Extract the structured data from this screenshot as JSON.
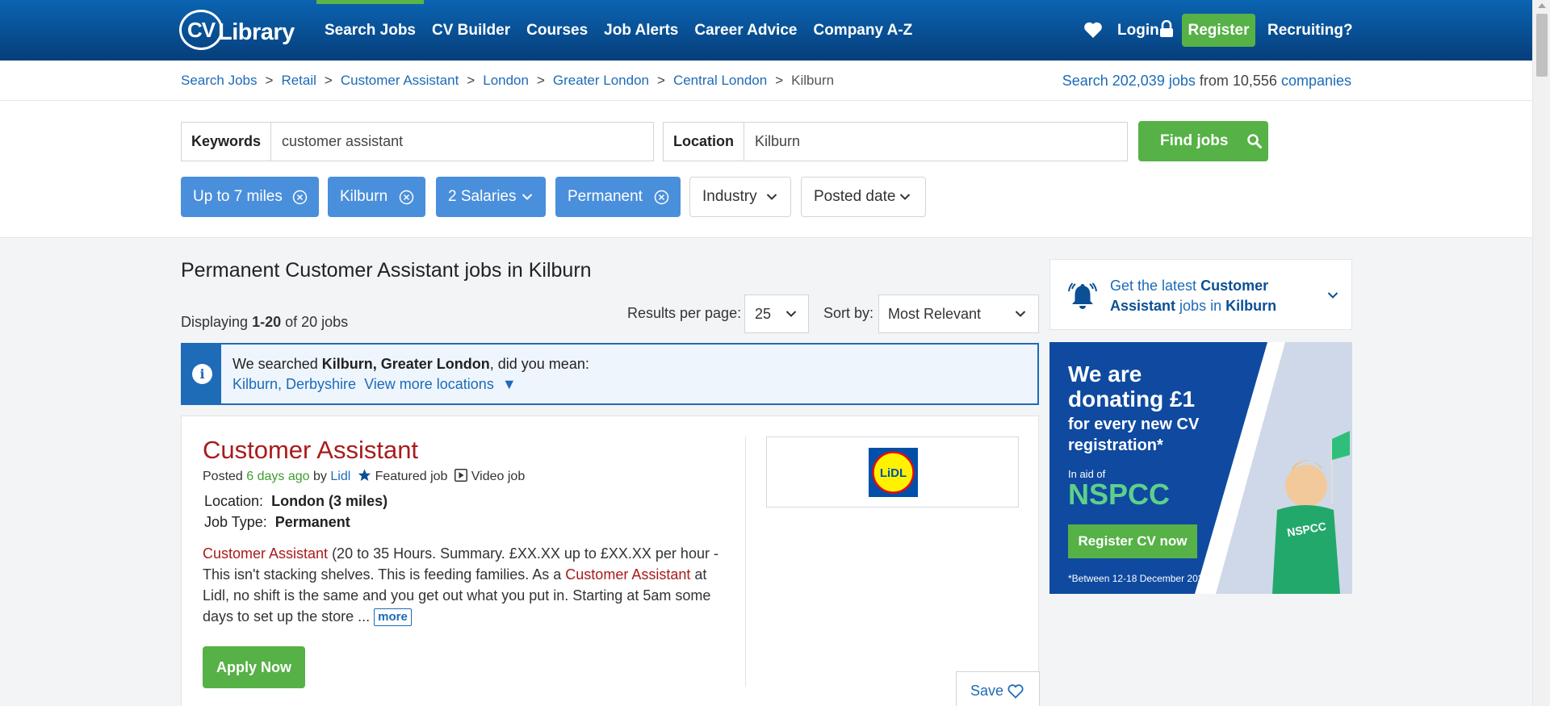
{
  "header": {
    "logo_text_cv": "CV",
    "logo_text_library": "Library",
    "nav": [
      "Search Jobs",
      "CV Builder",
      "Courses",
      "Job Alerts",
      "Career Advice",
      "Company A-Z"
    ],
    "active_nav_index": 0,
    "login_label": "Login",
    "register_label": "Register",
    "recruiting_label": "Recruiting?"
  },
  "breadcrumb": {
    "items": [
      "Search Jobs",
      "Retail",
      "Customer Assistant",
      "London",
      "Greater London",
      "Central London",
      "Kilburn"
    ],
    "separator": ">"
  },
  "stats": {
    "prefix": "Search",
    "jobs_link": "202,039 jobs",
    "middle": "from 10,556",
    "companies_link": "companies"
  },
  "search": {
    "keywords_label": "Keywords",
    "keywords_value": "customer assistant",
    "location_label": "Location",
    "location_value": "Kilburn",
    "find_label": "Find jobs"
  },
  "filters": [
    {
      "label": "Up to 7 miles",
      "active": true,
      "control": "clear"
    },
    {
      "label": "Kilburn",
      "active": true,
      "control": "clear"
    },
    {
      "label": "2 Salaries",
      "active": true,
      "control": "dropdown"
    },
    {
      "label": "Permanent",
      "active": true,
      "control": "clear"
    },
    {
      "label": "Industry",
      "active": false,
      "control": "dropdown"
    },
    {
      "label": "Posted date",
      "active": false,
      "control": "dropdown"
    }
  ],
  "results": {
    "title": "Permanent Customer Assistant jobs in Kilburn",
    "count_prefix": "Displaying",
    "count_range": "1-20",
    "count_suffix": "of 20 jobs",
    "per_page_label": "Results per page:",
    "per_page_value": "25",
    "sort_label": "Sort by:",
    "sort_value": "Most Relevant"
  },
  "did_you_mean": {
    "prefix": "We searched",
    "searched": "Kilburn, Greater London",
    "suffix": ", did you mean:",
    "suggestion": "Kilburn, Derbyshire",
    "more_label": "View more locations",
    "more_arrow": "▼"
  },
  "job": {
    "title": "Customer Assistant",
    "posted_prefix": "Posted",
    "posted_when": "6 days ago",
    "posted_by": "by",
    "company": "Lidl",
    "featured_label": "Featured job",
    "video_label": "Video job",
    "location_label": "Location:",
    "location_value": "London (3 miles)",
    "type_label": "Job Type:",
    "type_value": "Permanent",
    "desc_hl1": "Customer Assistant",
    "desc_1": " (20 to 35 Hours. Summary. £XX.XX up to £XX.XX per hour - This isn't stacking shelves. This is feeding families. As a ",
    "desc_hl2": "Customer Assistant",
    "desc_2": " at Lidl, no shift is the same and you get out what you put in. Starting at 5am some days to set up the store ...",
    "more_label": "more",
    "apply_label": "Apply Now",
    "save_label": "Save",
    "logo_text": "LiDL"
  },
  "job_alert": {
    "prefix": "Get the latest",
    "keyword": "Customer Assistant",
    "middle": "jobs in",
    "location": "Kilburn"
  },
  "promo": {
    "line1": "We are",
    "line2": "donating £1",
    "line3": "for every new CV",
    "line4": "registration*",
    "line5": "In aid of",
    "line6": "NSPCC",
    "button": "Register CV now",
    "footnote": "*Between 12-18 December 2022",
    "shirt_text": "NSPCC"
  },
  "colors": {
    "header_top": "#0b64b2",
    "header_bottom": "#063e7a",
    "green": "#56b146",
    "link_blue": "#1c6bb7",
    "chip_blue": "#4a8fdb",
    "title_red": "#a91b1b"
  }
}
